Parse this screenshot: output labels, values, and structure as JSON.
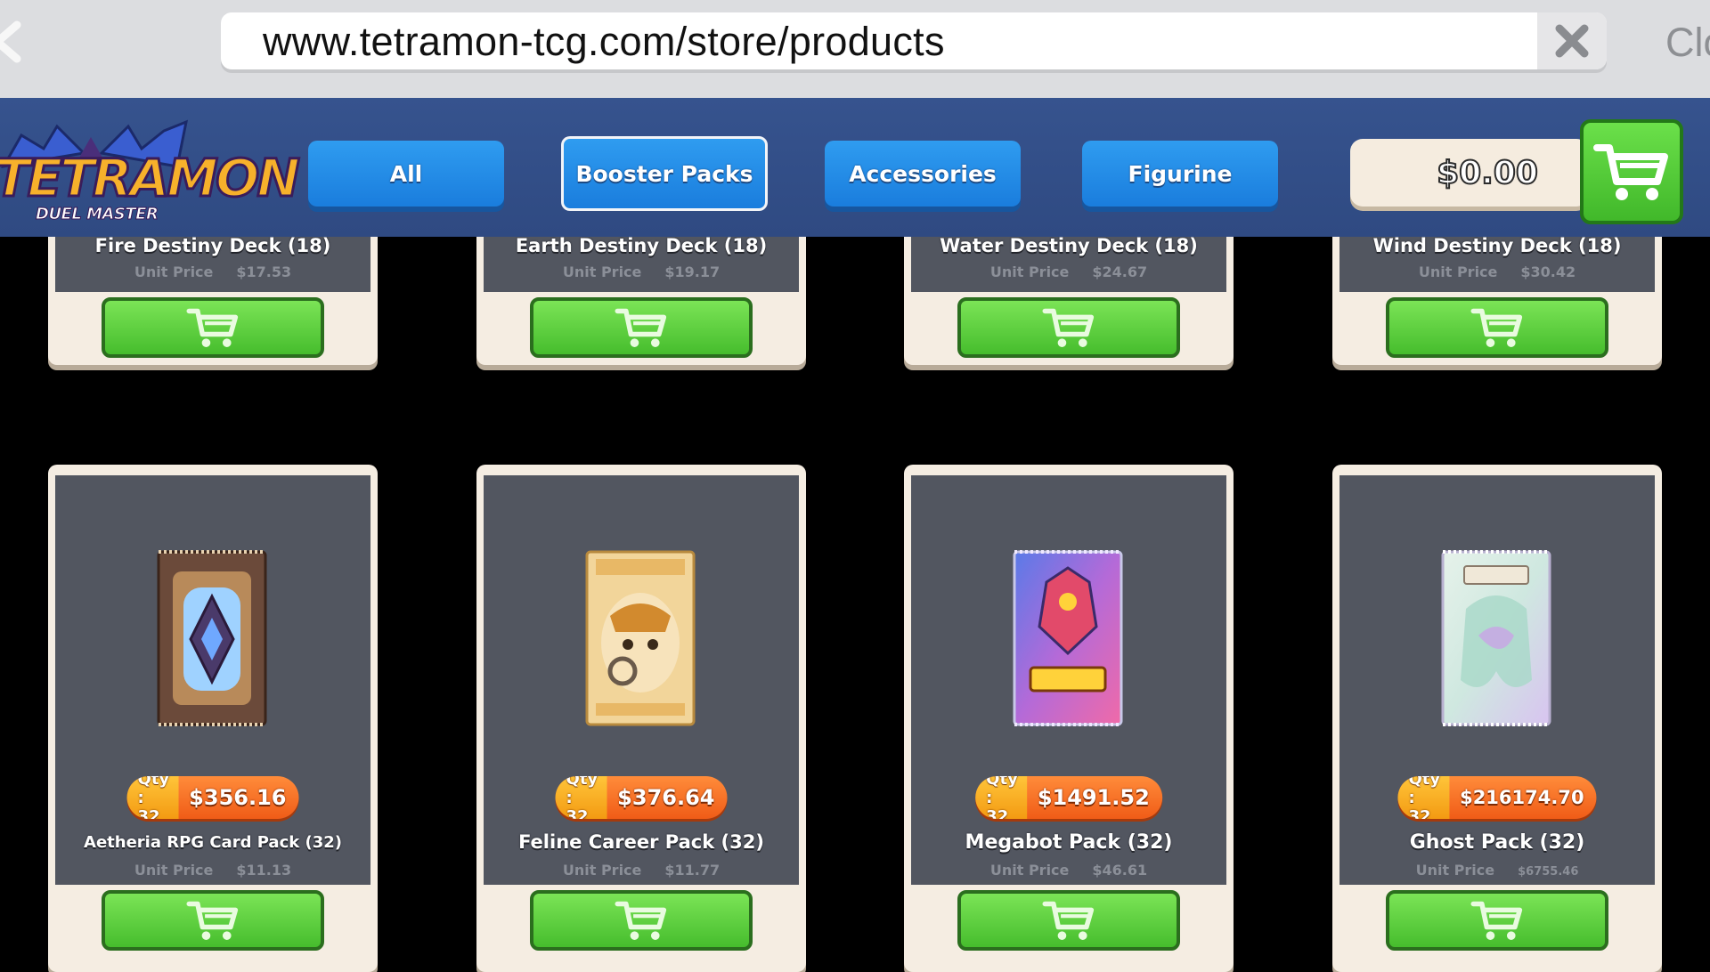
{
  "browser": {
    "url": "www.tetramon-tcg.com/store/products",
    "close_label": "Clo"
  },
  "header": {
    "logo_title": "TETRAMON",
    "logo_subtitle": "DUEL MASTER",
    "tabs": [
      {
        "label": "All",
        "active": false
      },
      {
        "label": "Booster Packs",
        "active": true
      },
      {
        "label": "Accessories",
        "active": false
      },
      {
        "label": "Figurine",
        "active": false
      }
    ],
    "balance": "$0.00"
  },
  "unit_price_label": "Unit Price",
  "qty_label": "Qty : 32",
  "top_row": [
    {
      "name": "Fire Destiny Deck (18)",
      "unit_price": "$17.53"
    },
    {
      "name": "Earth Destiny Deck (18)",
      "unit_price": "$19.17"
    },
    {
      "name": "Water Destiny Deck (18)",
      "unit_price": "$24.67"
    },
    {
      "name": "Wind Destiny Deck (18)",
      "unit_price": "$30.42"
    }
  ],
  "bottom_row": [
    {
      "name": "Aetheria RPG Card Pack (32)",
      "qty": "Qty : 32",
      "price": "$356.16",
      "unit_price": "$11.13",
      "pack_color": "#6b4a3a",
      "accent": "#9fd2ff"
    },
    {
      "name": "Feline Career Pack (32)",
      "qty": "Qty : 32",
      "price": "$376.64",
      "unit_price": "$11.77",
      "pack_color": "#f2d59a",
      "accent": "#d28a2e"
    },
    {
      "name": "Megabot Pack (32)",
      "qty": "Qty : 32",
      "price": "$1491.52",
      "unit_price": "$46.61",
      "pack_color": "#8e6fd8",
      "accent": "#f06aa8"
    },
    {
      "name": "Ghost Pack (32)",
      "qty": "Qty : 32",
      "price": "$216174.70",
      "unit_price": "$6755.46",
      "pack_color": "#cfe8e0",
      "accent": "#c9a4e6"
    }
  ],
  "colors": {
    "header_bg": "#36538e",
    "tab_blue": "#2f9cf0",
    "buy_green": "#5fd03f",
    "price_orange": "#f05c17"
  }
}
